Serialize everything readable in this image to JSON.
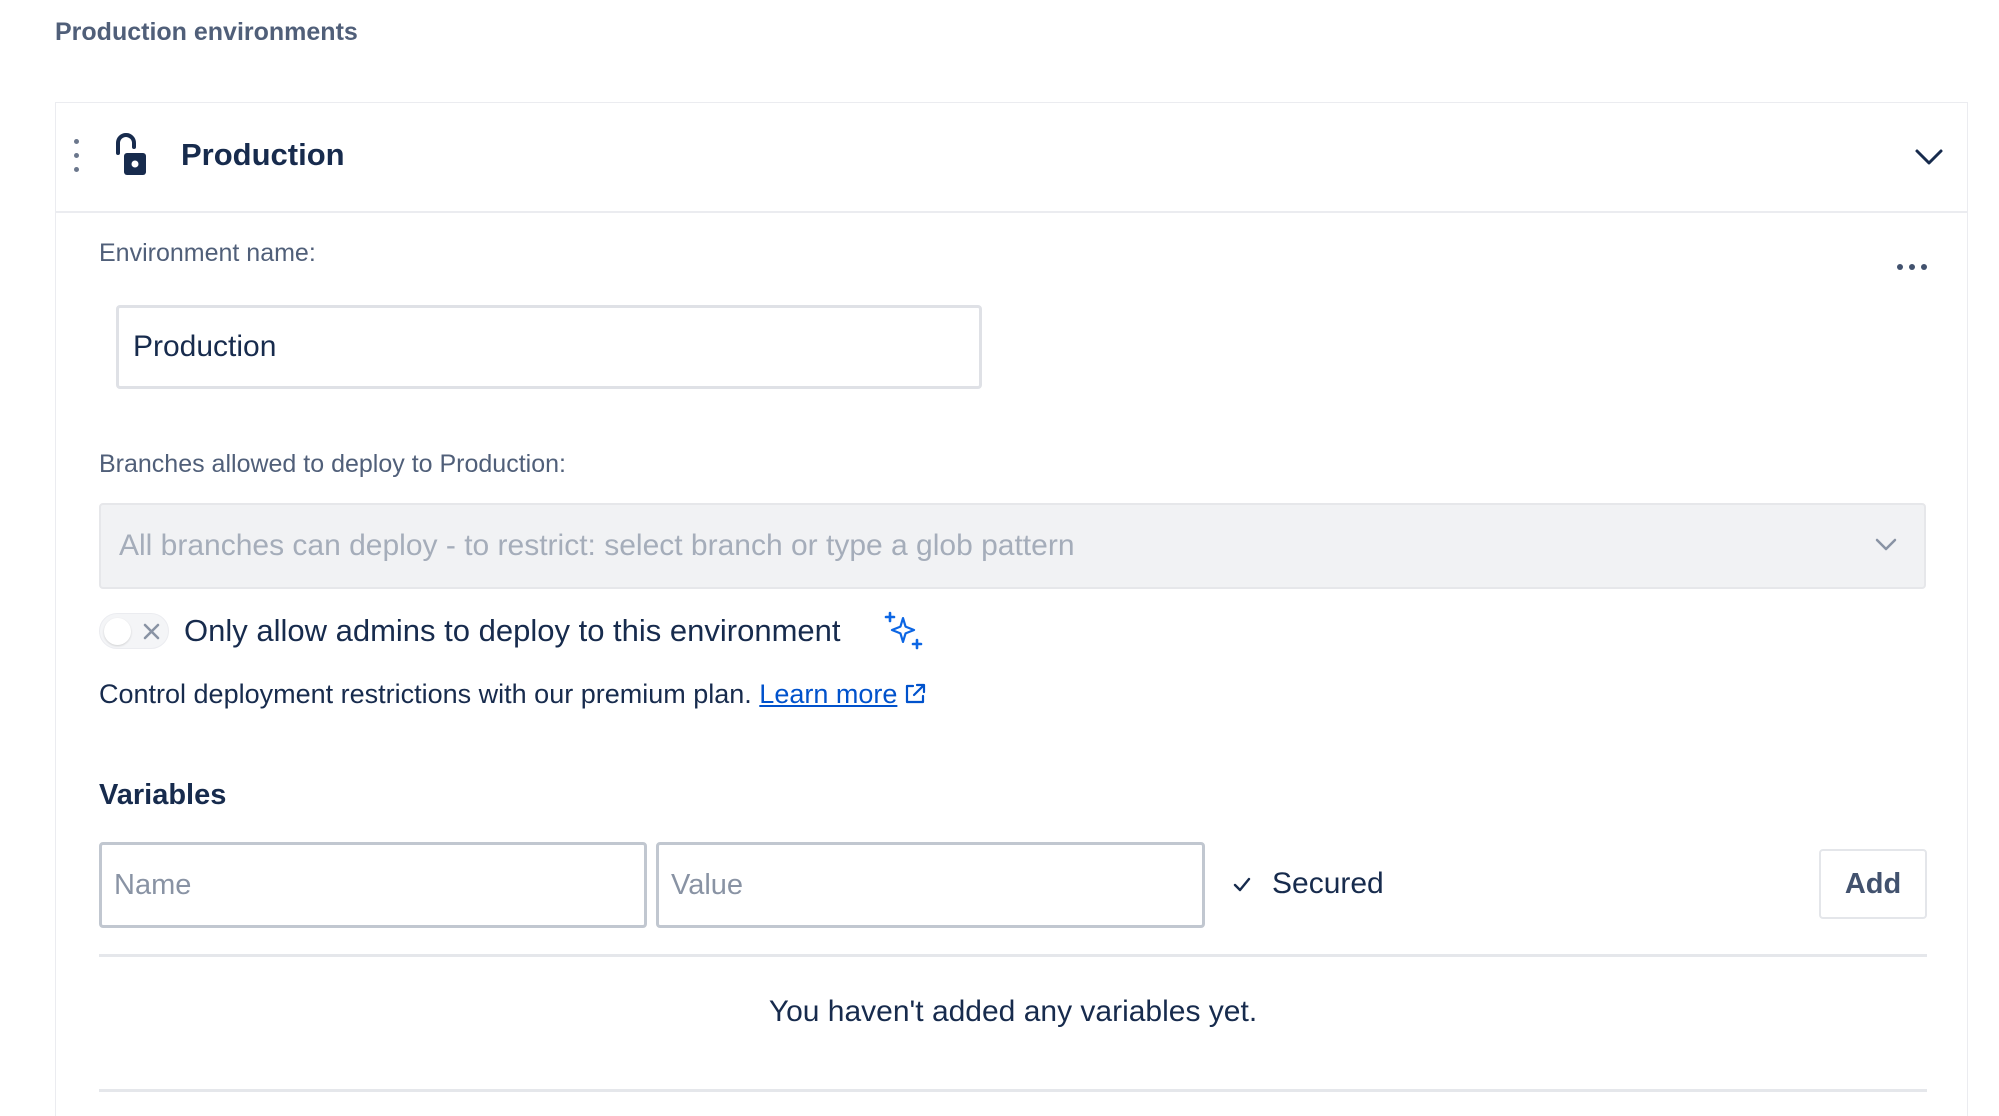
{
  "page": {
    "heading": "Production environments"
  },
  "environment": {
    "title": "Production",
    "name_label": "Environment name:",
    "name_value": "Production",
    "branches_label": "Branches allowed to deploy to Production:",
    "branches_placeholder": "All branches can deploy - to restrict: select branch or type a glob pattern",
    "admins_toggle": {
      "label": "Only allow admins to deploy to this environment",
      "enabled": false
    },
    "premium_note": "Control deployment restrictions with our premium plan.",
    "learn_more_label": "Learn more"
  },
  "variables": {
    "title": "Variables",
    "name_placeholder": "Name",
    "value_placeholder": "Value",
    "secured_label": "Secured",
    "secured_checked": true,
    "add_label": "Add",
    "empty_message": "You haven't added any variables yet."
  },
  "icons": {
    "drag": "drag-handle-icon",
    "lock": "unlock-icon",
    "collapse": "chevron-down-icon",
    "more": "more-icon",
    "sparkle": "sparkle-icon",
    "external": "external-link-icon"
  },
  "colors": {
    "link": "#0052cc",
    "sparkle": "#0c66e4",
    "text": "#172b4d",
    "muted": "#505f79"
  }
}
